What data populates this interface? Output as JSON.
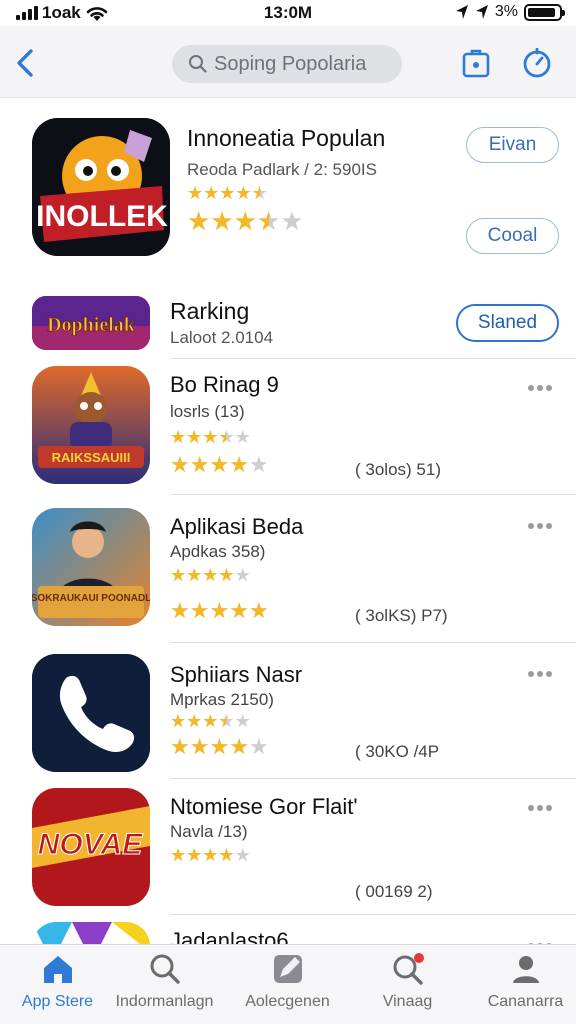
{
  "status_bar": {
    "carrier": "1oak",
    "time": "13:0M",
    "battery": "3%",
    "battery_level": 0.9
  },
  "search": {
    "placeholder": "Soping Popolaria"
  },
  "featured": {
    "title": "Innoneatia Populan",
    "subtitle": "Reoda Padlark / 2: 590IS",
    "icon_text": "INOLLEK",
    "rating_small": 4.5,
    "rating_large": 3.5,
    "btn_top": "Eivan",
    "btn_bottom": "Cooal"
  },
  "ranking": {
    "banner_text": "Dophielak",
    "title": "Rarking",
    "subtitle": "Laloot 2.0104",
    "button": "Slaned"
  },
  "apps": [
    {
      "name": "Bo Rinag 9",
      "sub": "losrls (13)",
      "count": "( 3olos) 51)",
      "icon_text": "RAIKSSAUIII",
      "rating_small": 3.5,
      "rating_large": 4
    },
    {
      "name": "Aplikasi Beda",
      "sub": "Apdkas 358)",
      "count": "( 3olKS) P7)",
      "icon_text": "SOKRAUKAUI POONADL",
      "rating_small": 4,
      "rating_large": 5
    },
    {
      "name": "Sphiiars Nasr",
      "sub": "Mprkas 2150)",
      "count": "( 30KO /4P",
      "icon_text": "",
      "rating_small": 3.5,
      "rating_large": 4
    },
    {
      "name": "Ntomiese Gor Flait'",
      "sub": "Navla /13)",
      "count": "( 00169 2)",
      "icon_text": "NOVAE",
      "rating_small": 4,
      "rating_large": 0
    },
    {
      "name": "Jadanlasto6",
      "sub": "",
      "count": "",
      "icon_text": "",
      "rating_small": 0,
      "rating_large": 0
    }
  ],
  "tabs": [
    {
      "label": "App Stere",
      "icon": "app-store-home-icon",
      "active": true
    },
    {
      "label": "Indormanlagn",
      "icon": "search-icon",
      "active": false
    },
    {
      "label": "Aolecgenen",
      "icon": "pencil-icon",
      "active": false
    },
    {
      "label": "Vinaag",
      "icon": "search-badge-icon",
      "active": false
    },
    {
      "label": "Cananarra",
      "icon": "person-icon",
      "active": false
    }
  ],
  "colors": {
    "accent": "#2f7ad6",
    "star": "#f4b824",
    "star_empty": "#cdcdd2"
  }
}
